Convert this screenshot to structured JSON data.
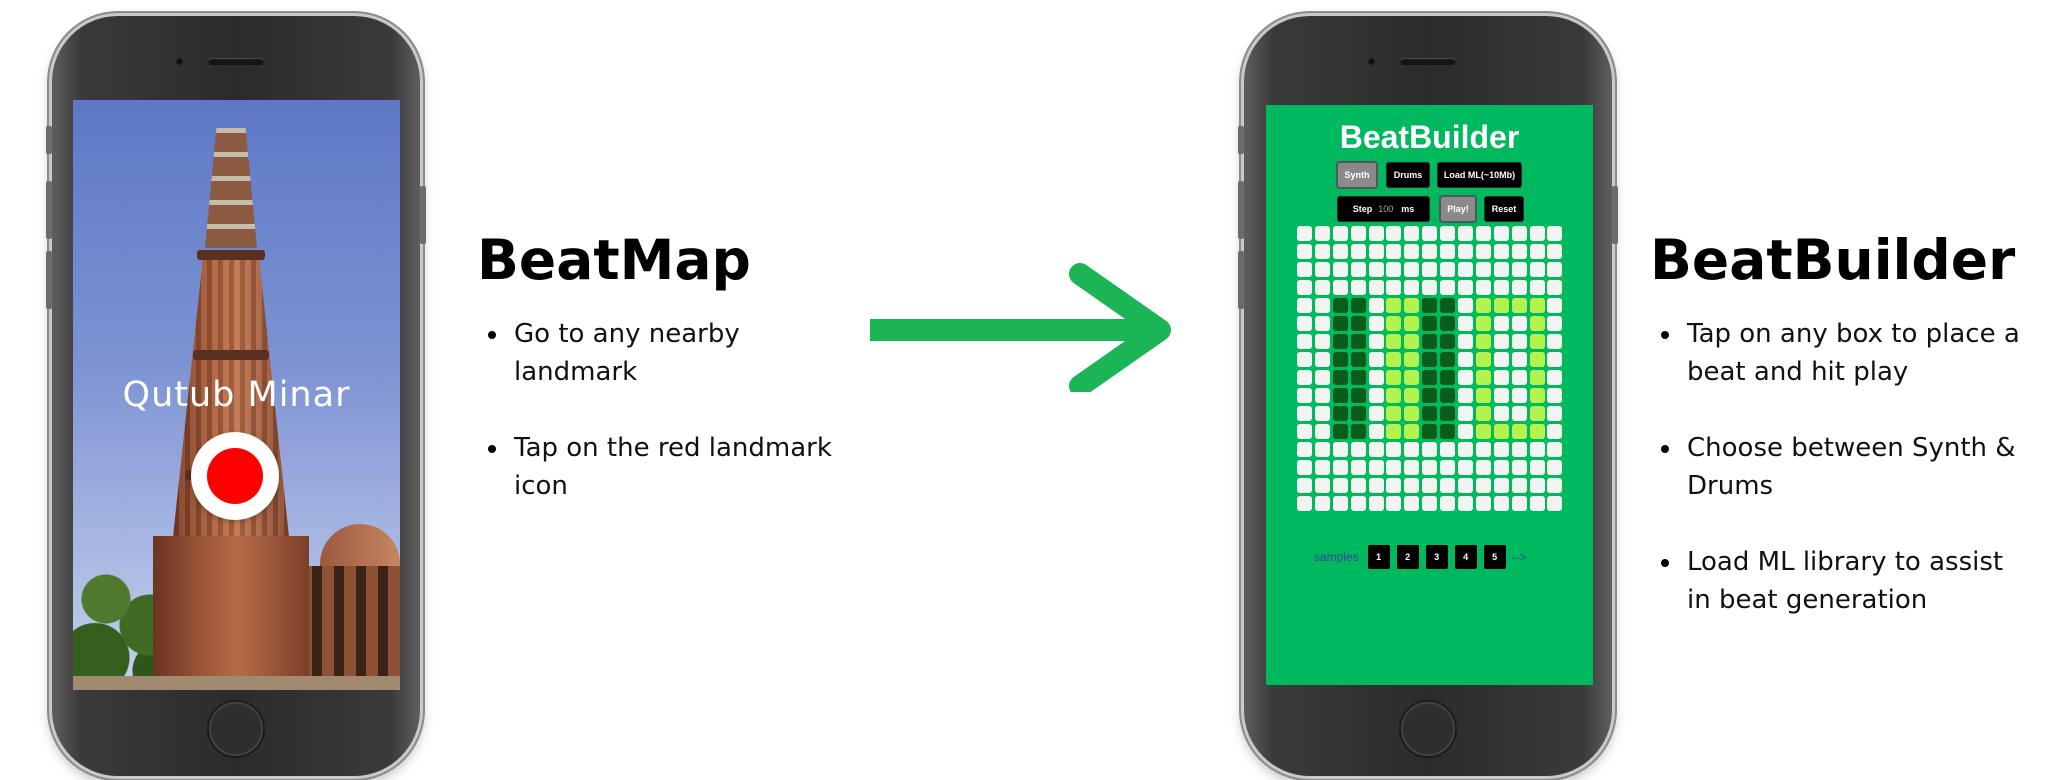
{
  "left_panel": {
    "app_name": "BeatMap",
    "landmark_label": "Qutub Minar",
    "bullets": [
      "Go to any nearby landmark",
      "Tap on the red landmark icon"
    ]
  },
  "right_panel": {
    "app_name": "BeatBuilder",
    "bullets": [
      "Tap on any box to place a beat and hit play",
      "Choose between Synth & Drums",
      "Load ML library to assist in beat generation"
    ]
  },
  "beatbuilder_app": {
    "title": "BeatBuilder",
    "buttons": {
      "synth": "Synth",
      "drums": "Drums",
      "load_ml": "Load ML(~10Mb)",
      "step_label": "Step",
      "step_value": "100",
      "step_unit": "ms",
      "play": "Play!",
      "reset": "Reset"
    },
    "samples_label": "samples",
    "sample_buttons": [
      "1",
      "2",
      "3",
      "4",
      "5"
    ],
    "samples_arrow": "-->",
    "grid": {
      "columns": 15,
      "rows": 16,
      "dark_cells": [
        [
          4,
          2
        ],
        [
          4,
          3
        ],
        [
          5,
          2
        ],
        [
          5,
          3
        ],
        [
          6,
          2
        ],
        [
          6,
          3
        ],
        [
          7,
          2
        ],
        [
          7,
          3
        ],
        [
          8,
          2
        ],
        [
          8,
          3
        ],
        [
          9,
          2
        ],
        [
          9,
          3
        ],
        [
          10,
          2
        ],
        [
          10,
          3
        ],
        [
          11,
          2
        ],
        [
          11,
          3
        ],
        [
          4,
          7
        ],
        [
          4,
          8
        ],
        [
          5,
          7
        ],
        [
          5,
          8
        ],
        [
          6,
          7
        ],
        [
          6,
          8
        ],
        [
          7,
          7
        ],
        [
          7,
          8
        ],
        [
          8,
          7
        ],
        [
          8,
          8
        ],
        [
          9,
          7
        ],
        [
          9,
          8
        ],
        [
          10,
          7
        ],
        [
          10,
          8
        ],
        [
          11,
          7
        ],
        [
          11,
          8
        ]
      ],
      "lime_cells": [
        [
          4,
          5
        ],
        [
          4,
          6
        ],
        [
          5,
          5
        ],
        [
          5,
          6
        ],
        [
          6,
          5
        ],
        [
          6,
          6
        ],
        [
          7,
          5
        ],
        [
          7,
          6
        ],
        [
          8,
          5
        ],
        [
          8,
          6
        ],
        [
          9,
          5
        ],
        [
          9,
          6
        ],
        [
          10,
          5
        ],
        [
          10,
          6
        ],
        [
          11,
          5
        ],
        [
          11,
          6
        ],
        [
          4,
          10
        ],
        [
          4,
          11
        ],
        [
          4,
          12
        ],
        [
          4,
          13
        ],
        [
          5,
          10
        ],
        [
          5,
          13
        ],
        [
          6,
          10
        ],
        [
          6,
          13
        ],
        [
          7,
          10
        ],
        [
          7,
          13
        ],
        [
          8,
          10
        ],
        [
          8,
          13
        ],
        [
          9,
          10
        ],
        [
          9,
          13
        ],
        [
          10,
          10
        ],
        [
          10,
          13
        ],
        [
          11,
          10
        ],
        [
          11,
          11
        ],
        [
          11,
          12
        ],
        [
          11,
          13
        ]
      ]
    }
  },
  "colors": {
    "app_green": "#00b95e",
    "arrow_green": "#1bb556",
    "landmark_red": "#ff0000",
    "cell_dark": "#0a5d18",
    "cell_lime": "#b4f24d"
  },
  "icons": {
    "arrow": "arrow-right-icon",
    "landmark": "landmark-marker-icon"
  }
}
